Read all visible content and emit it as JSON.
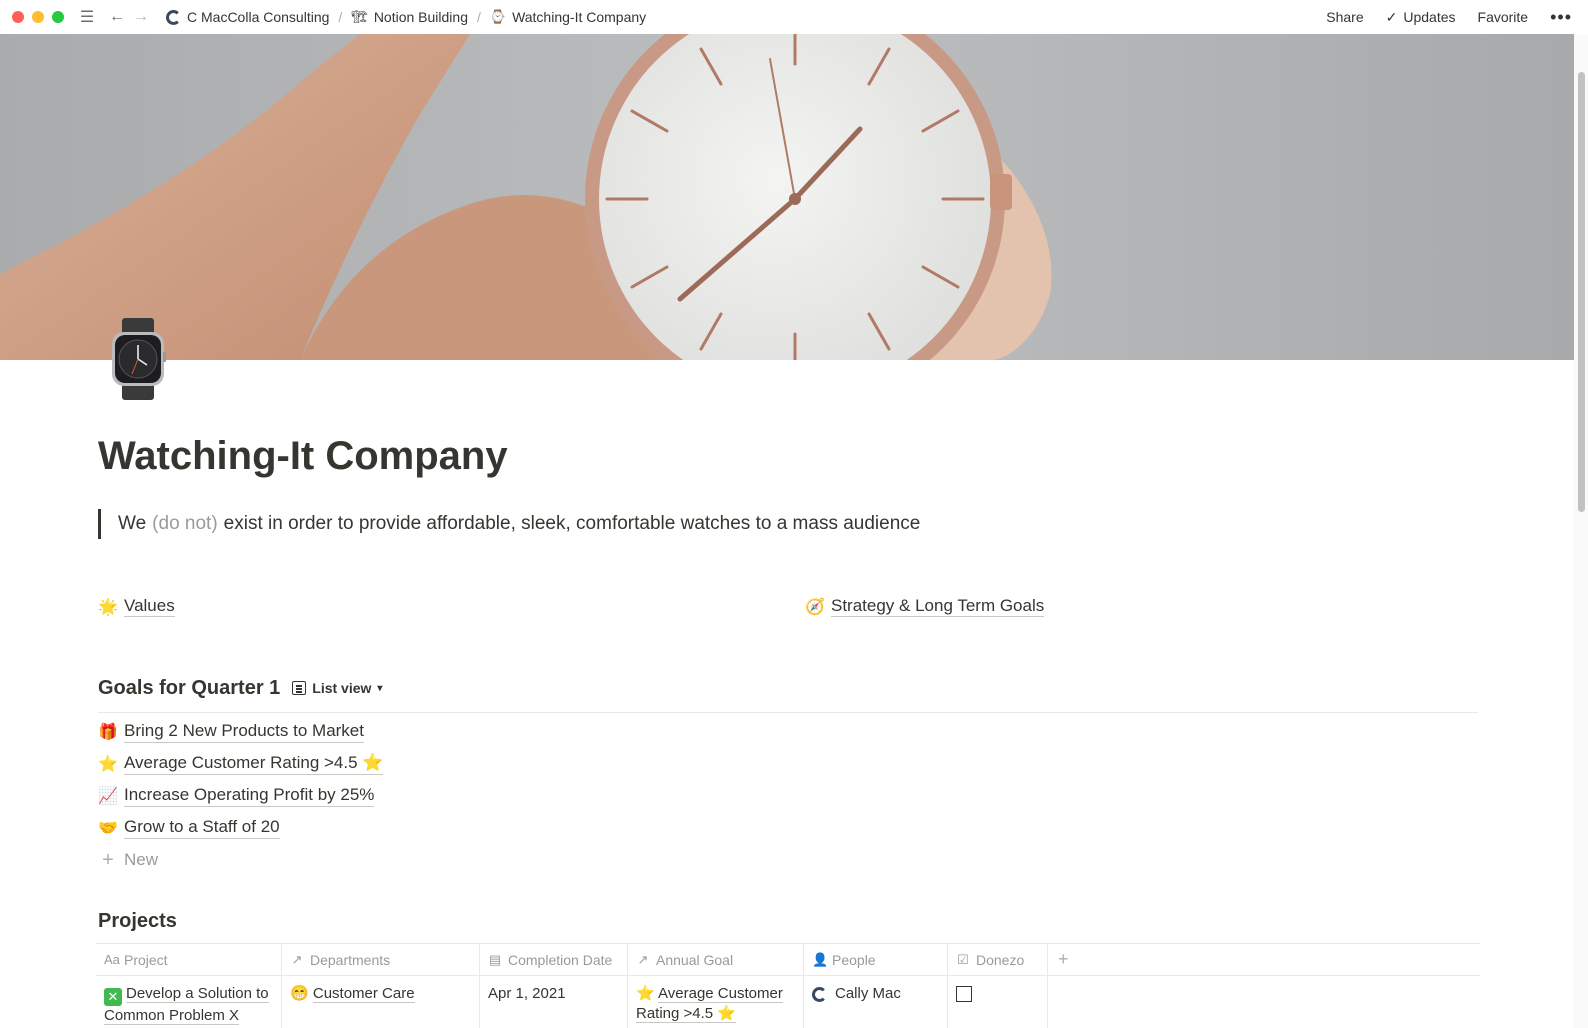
{
  "topbar": {
    "breadcrumbs": [
      {
        "label": "C MacColla Consulting",
        "icon": "c-logo-icon"
      },
      {
        "label": "Notion Building",
        "icon": "building-icon"
      },
      {
        "label": "Watching-It Company",
        "icon": "watch-icon"
      }
    ],
    "separator": "/",
    "share_label": "Share",
    "updates_label": "Updates",
    "favorite_label": "Favorite"
  },
  "page": {
    "title": "Watching-It Company",
    "quote": {
      "prefix": "We",
      "muted": "(do not)",
      "suffix": "exist in order to provide affordable, sleek, comfortable watches to a mass audience"
    },
    "links": [
      {
        "emoji": "🌟",
        "label": "Values"
      },
      {
        "emoji": "🧭",
        "label": "Strategy & Long Term Goals"
      }
    ]
  },
  "goals": {
    "heading": "Goals for Quarter 1",
    "view_label": "List view",
    "items": [
      {
        "emoji": "🎁",
        "label": "Bring 2 New Products to Market"
      },
      {
        "emoji": "⭐",
        "label": "Average Customer Rating >4.5 ⭐"
      },
      {
        "emoji": "📈",
        "label": "Increase Operating Profit by 25%"
      },
      {
        "emoji": "🤝",
        "label": "Grow to a Staff of 20"
      }
    ],
    "new_label": "New"
  },
  "projects": {
    "heading": "Projects",
    "columns": [
      {
        "label": "Project",
        "icon": "Aa"
      },
      {
        "label": "Departments",
        "icon": "↗"
      },
      {
        "label": "Completion Date",
        "icon": "▤"
      },
      {
        "label": "Annual Goal",
        "icon": "↗"
      },
      {
        "label": "People",
        "icon": "👤"
      },
      {
        "label": "Donezo",
        "icon": "☑"
      }
    ],
    "rows": [
      {
        "project": "Develop a Solution to Common Problem X",
        "department_emoji": "😁",
        "department": "Customer Care",
        "completion_date": "Apr 1, 2021",
        "annual_goal_emoji": "⭐",
        "annual_goal": "Average Customer Rating >4.5 ⭐",
        "person": "Cally Mac",
        "done": false
      }
    ]
  }
}
